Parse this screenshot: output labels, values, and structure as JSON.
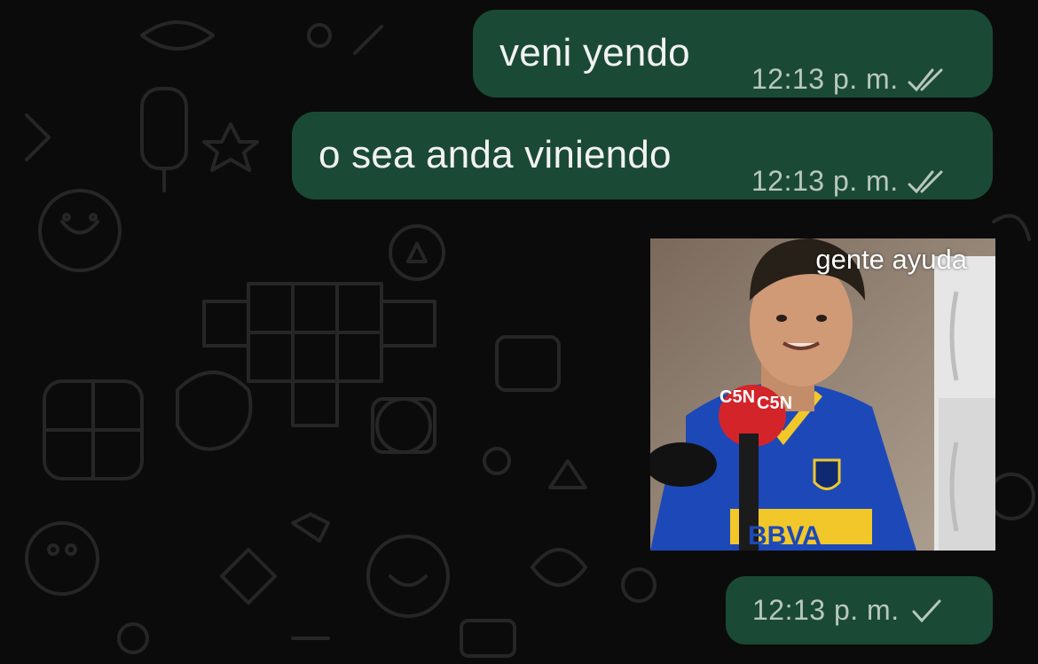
{
  "messages": [
    {
      "text": "veni yendo",
      "time": "12:13 p. m.",
      "status": "read-double-tick"
    },
    {
      "text": "o sea anda viniendo",
      "time": "12:13 p. m.",
      "status": "read-double-tick"
    }
  ],
  "sticker": {
    "caption": "gente ayuda",
    "mic_logo": "C5N",
    "shirt_sponsor": "BBVA",
    "time": "12:13 p. m.",
    "status": "sent-single-tick"
  },
  "colors": {
    "bubble_outgoing": "#1a4a35",
    "background": "#0b0b0b",
    "meta_text": "#b9c7bf"
  }
}
